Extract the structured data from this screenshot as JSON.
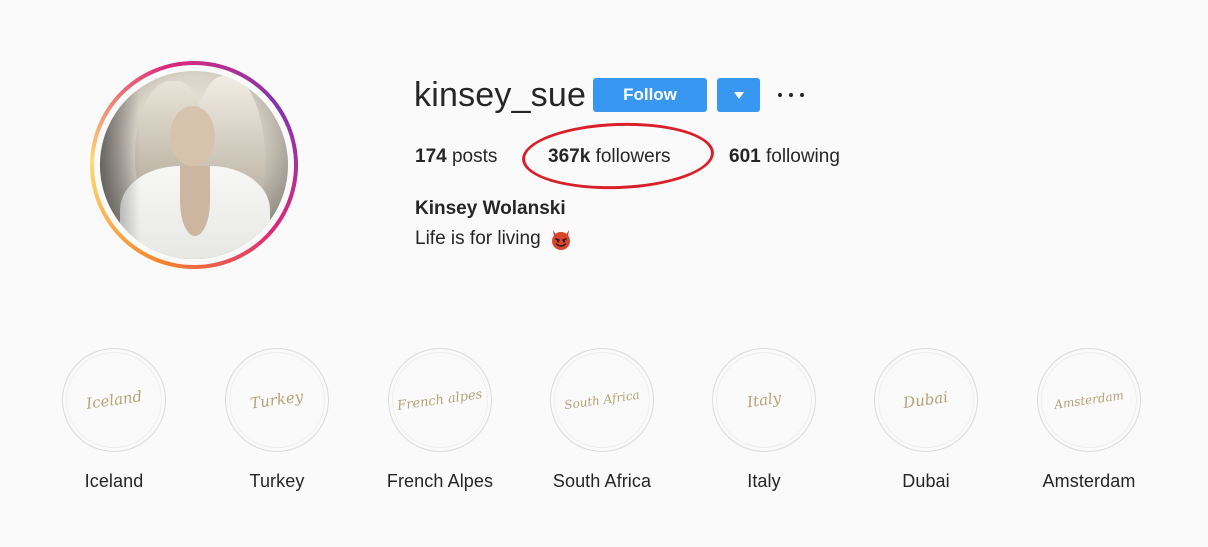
{
  "profile": {
    "username": "kinsey_sue",
    "full_name": "Kinsey Wolanski",
    "bio_text": "Life is for living",
    "bio_emoji_icon": "smiling-devil-icon",
    "avatar_icon": "profile-photo"
  },
  "actions": {
    "follow_label": "Follow",
    "dropdown_icon": "triangle-down-icon",
    "more_icon": "more-options-icon",
    "accent_color": "#3897f0"
  },
  "stats": {
    "posts_count": "174",
    "posts_label": "posts",
    "followers_count": "367k",
    "followers_label": "followers",
    "following_count": "601",
    "following_label": "following"
  },
  "annotation": {
    "type": "red ellipse around followers",
    "color": "#d9202a"
  },
  "highlights": [
    {
      "cover_text": "Iceland",
      "label": "Iceland"
    },
    {
      "cover_text": "Turkey",
      "label": "Turkey"
    },
    {
      "cover_text": "French alpes",
      "label": "French Alpes"
    },
    {
      "cover_text": "South Africa",
      "label": "South Africa"
    },
    {
      "cover_text": "Italy",
      "label": "Italy"
    },
    {
      "cover_text": "Dubai",
      "label": "Dubai"
    },
    {
      "cover_text": "Amsterdam",
      "label": "Amsterdam"
    }
  ]
}
